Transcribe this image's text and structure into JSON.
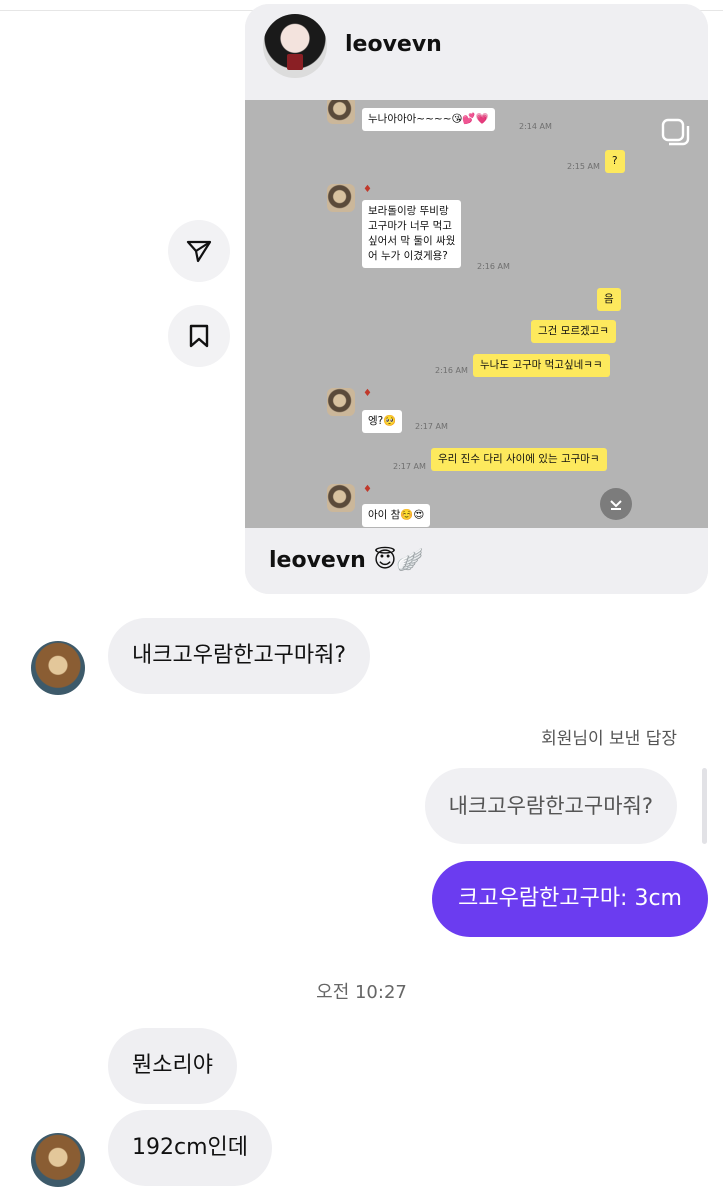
{
  "shared_post": {
    "username": "leovevn",
    "caption": "leovevn 😇🪽",
    "screenshot_messages": [
      {
        "side": "in",
        "text": "누나아아아~~~~😘💕💗",
        "time": "2:14 AM"
      },
      {
        "side": "out",
        "text": "?",
        "time": "2:15 AM"
      },
      {
        "side": "in",
        "text": "보라돌이랑 뚜비랑\n고구마가 너무 먹고\n싶어서 막 둘이 싸웠\n어 누가 이겼게용?",
        "time": "2:16 AM"
      },
      {
        "side": "out",
        "text": "음",
        "time": ""
      },
      {
        "side": "out",
        "text": "그건 모르겠고ㅋ",
        "time": ""
      },
      {
        "side": "out",
        "text": "누나도 고구마 먹고싶네ㅋㅋ",
        "time": "2:16 AM"
      },
      {
        "side": "in",
        "text": "엥?🥺",
        "time": "2:17 AM"
      },
      {
        "side": "out",
        "text": "우리 진수 다리 사이에 있는 고구마ㅋ",
        "time": "2:17 AM"
      },
      {
        "side": "in",
        "text": "아이 참☺️😍",
        "time": ""
      }
    ]
  },
  "messages": {
    "incoming_1": "내크고우람한고구마줘?",
    "reply_label": "회원님이 보낸 답장",
    "reply_quote": "내크고우람한고구마줘?",
    "outgoing_1": "크고우람한고구마: 3cm",
    "timestamp": "오전 10:27",
    "incoming_2": "뭔소리야",
    "incoming_3": "192cm인데"
  },
  "icons": {
    "share": "send-icon",
    "save": "bookmark-icon",
    "multi": "carousel-icon",
    "scroll_down": "chevron-down-icon"
  },
  "colors": {
    "outgoing_bubble": "#6b3cf0",
    "incoming_bubble": "#efeff2",
    "kakao_yellow": "#fde95d"
  }
}
